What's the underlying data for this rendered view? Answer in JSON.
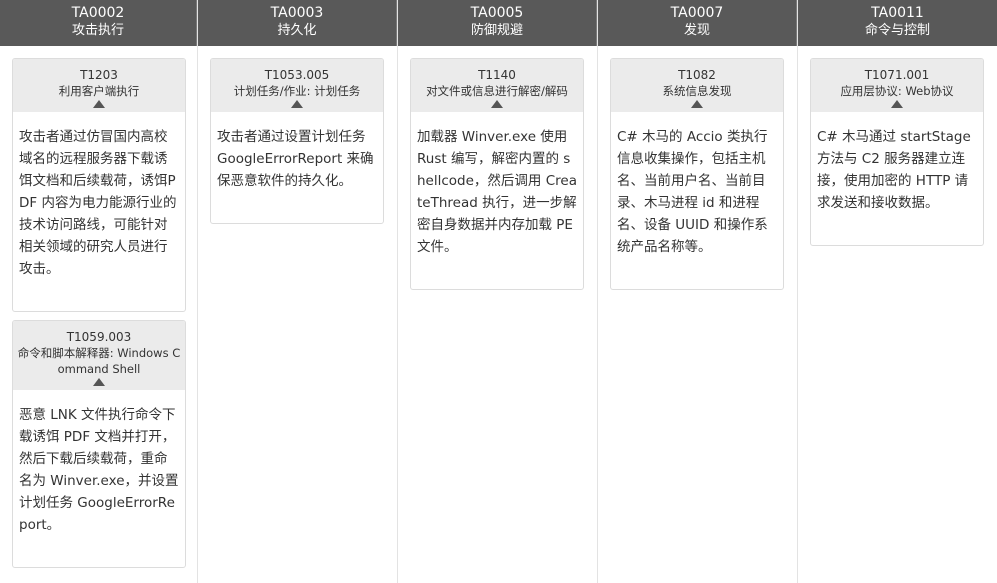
{
  "columns": [
    {
      "tactic_id": "TA0002",
      "tactic_name": "攻击执行",
      "cards": [
        {
          "technique_id": "T1203",
          "technique_name": "利用客户端执行",
          "description": "攻击者通过仿冒国内高校域名的远程服务器下载诱饵文档和后续载荷，诱饵PDF 内容为电力能源行业的技术访问路线，可能针对相关领域的研究人员进行攻击。"
        },
        {
          "technique_id": "T1059.003",
          "technique_name": "命令和脚本解释器: Windows Command Shell",
          "description": "恶意 LNK 文件执行命令下载诱饵 PDF 文档并打开，然后下载后续载荷，重命名为 Winver.exe，并设置计划任务 GoogleErrorReport。"
        }
      ]
    },
    {
      "tactic_id": "TA0003",
      "tactic_name": "持久化",
      "cards": [
        {
          "technique_id": "T1053.005",
          "technique_name": "计划任务/作业: 计划任务",
          "description": "攻击者通过设置计划任务 GoogleErrorReport 来确保恶意软件的持久化。"
        }
      ]
    },
    {
      "tactic_id": "TA0005",
      "tactic_name": "防御规避",
      "cards": [
        {
          "technique_id": "T1140",
          "technique_name": "对文件或信息进行解密/解码",
          "description": "加载器 Winver.exe 使用 Rust 编写，解密内置的 shellcode，然后调用 CreateThread 执行，进一步解密自身数据并内存加载 PE 文件。"
        }
      ]
    },
    {
      "tactic_id": "TA0007",
      "tactic_name": "发现",
      "cards": [
        {
          "technique_id": "T1082",
          "technique_name": "系统信息发现",
          "description": "C# 木马的 Accio 类执行信息收集操作，包括主机名、当前用户名、当前目录、木马进程 id 和进程名、设备 UUID 和操作系统产品名称等。"
        }
      ]
    },
    {
      "tactic_id": "TA0011",
      "tactic_name": "命令与控制",
      "cards": [
        {
          "technique_id": "T1071.001",
          "technique_name": "应用层协议: Web协议",
          "description": "C# 木马通过 startStage 方法与 C2 服务器建立连接，使用加密的 HTTP 请求发送和接收数据。"
        }
      ]
    }
  ]
}
